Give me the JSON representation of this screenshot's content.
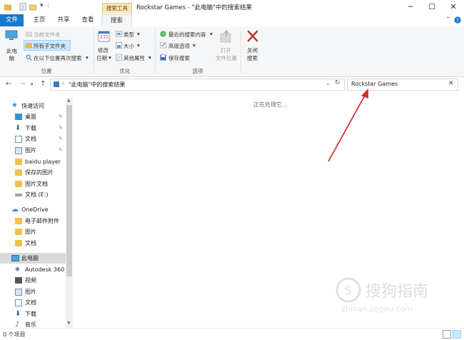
{
  "window": {
    "context_tab_label": "搜索工具",
    "title": "Rockstar Games - \"此电脑\"中的搜索结果",
    "minimize": "─",
    "maximize": "☐",
    "close": "✕"
  },
  "tabs": [
    "文件",
    "主页",
    "共享",
    "查看",
    "搜索"
  ],
  "ribbon": {
    "location": {
      "this_pc": "此电\n脑",
      "current_folder": "当前文件夹",
      "all_subfolders": "所有子文件夹",
      "search_again": "在以下位置再次搜索",
      "group": "位置"
    },
    "refine": {
      "date_modified_1": "修改",
      "date_modified_2": "日期",
      "kind": "类型",
      "size": "大小",
      "other_props": "其他属性",
      "group": "优化"
    },
    "options": {
      "recent_searches": "最近的搜索内容",
      "advanced": "高级选项",
      "save_search": "保存搜索",
      "open_location_1": "打开",
      "open_location_2": "文件位置",
      "group": "选项"
    },
    "close": {
      "label_1": "关闭",
      "label_2": "搜索"
    }
  },
  "address": {
    "path": "\"此电脑\"中的搜索结果",
    "search_value": "Rockstar Games"
  },
  "nav": {
    "quick_access": "快速访问",
    "desktop": "桌面",
    "downloads": "下载",
    "documents": "文档",
    "pictures": "图片",
    "baidu_player": "baidu player",
    "saved_pictures": "保存的图片",
    "picture_docs": "图片文档",
    "drive_e": "文档 (E:)",
    "onedrive": "OneDrive",
    "email_attachments": "电子邮件附件",
    "od_pictures": "图片",
    "od_documents": "文档",
    "this_pc": "此电脑",
    "autodesk": "Autodesk 360",
    "videos": "视频",
    "pc_pictures": "图片",
    "pc_documents": "文档",
    "pc_downloads": "下载",
    "music": "音乐"
  },
  "content": {
    "processing": "正在处理它..."
  },
  "status": {
    "count": "0 个项目"
  },
  "watermark": {
    "brand": "搜狗指南",
    "url": "zhinan.sogou.com"
  },
  "colors": {
    "accent": "#1979ca",
    "arrow": "#d32f2f",
    "context_tab": "#fbe7b9",
    "selected": "#cce8ff"
  }
}
